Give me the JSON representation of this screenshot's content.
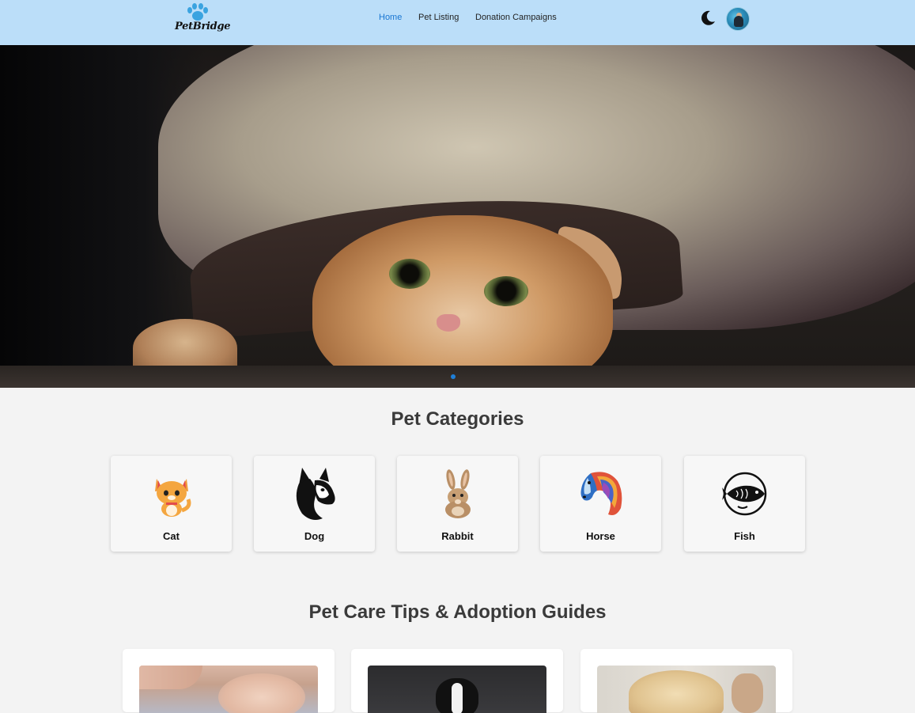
{
  "brand": {
    "name": "PetBridge",
    "accent": "#1976d2",
    "nav_bg": "#bbdef9"
  },
  "nav": {
    "links": [
      {
        "label": "Home",
        "active": true
      },
      {
        "label": "Pet Listing",
        "active": false
      },
      {
        "label": "Donation Campaigns",
        "active": false
      }
    ],
    "theme_toggle_icon": "moon-icon",
    "avatar_icon": "user-avatar"
  },
  "hero": {
    "image": "cat-under-blanket-photo",
    "carousel_active_index": 0
  },
  "categories": {
    "title": "Pet Categories",
    "items": [
      {
        "label": "Cat",
        "icon": "cat-icon"
      },
      {
        "label": "Dog",
        "icon": "dog-icon"
      },
      {
        "label": "Rabbit",
        "icon": "rabbit-icon"
      },
      {
        "label": "Horse",
        "icon": "horse-icon"
      },
      {
        "label": "Fish",
        "icon": "fish-icon"
      }
    ]
  },
  "tips": {
    "title": "Pet Care Tips & Adoption Guides",
    "cards": [
      {
        "image": "petting-cat-photo"
      },
      {
        "image": "border-collie-photo"
      },
      {
        "image": "golden-retriever-photo"
      }
    ]
  }
}
